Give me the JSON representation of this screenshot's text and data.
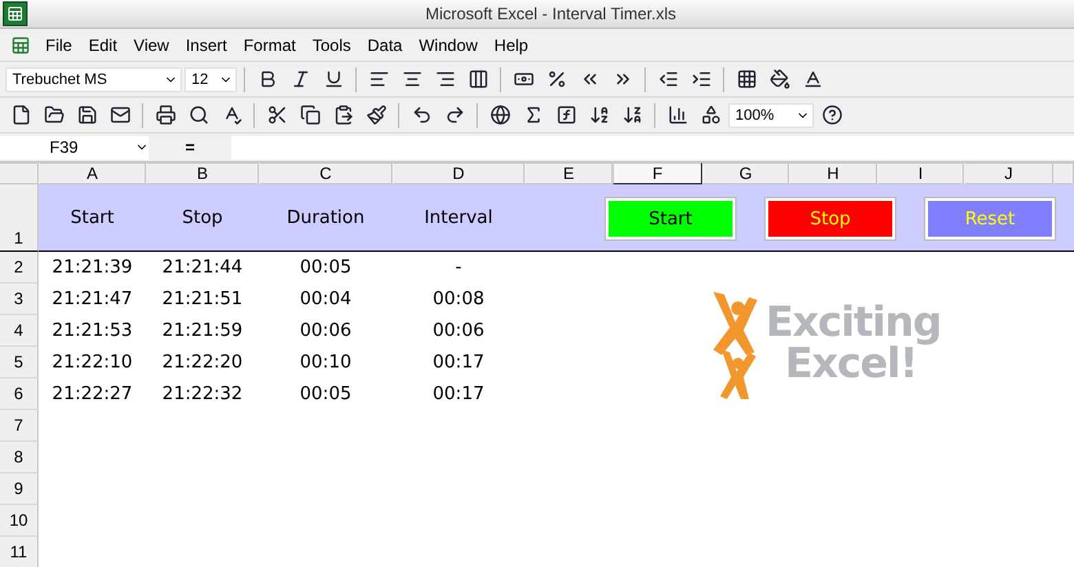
{
  "window": {
    "title": "Microsoft Excel - Interval Timer.xls"
  },
  "menu": [
    "File",
    "Edit",
    "View",
    "Insert",
    "Format",
    "Tools",
    "Data",
    "Window",
    "Help"
  ],
  "formatting_toolbar": {
    "font": "Trebuchet MS",
    "size": "12"
  },
  "standard_toolbar": {
    "zoom": "100%"
  },
  "formula_bar": {
    "name_box": "F39",
    "equals": "="
  },
  "columns": [
    {
      "label": "A",
      "selected": false
    },
    {
      "label": "B",
      "selected": false
    },
    {
      "label": "C",
      "selected": false
    },
    {
      "label": "D",
      "selected": false
    },
    {
      "label": "E",
      "selected": false
    },
    {
      "label": "F",
      "selected": true
    },
    {
      "label": "G",
      "selected": false
    },
    {
      "label": "H",
      "selected": false
    },
    {
      "label": "I",
      "selected": false
    },
    {
      "label": "J",
      "selected": false
    }
  ],
  "rows": [
    {
      "number": "1",
      "cells": [
        "Start",
        "Stop",
        "Duration",
        "Interval"
      ]
    },
    {
      "number": "2",
      "cells": [
        "21:21:39",
        "21:21:44",
        "00:05",
        "-"
      ]
    },
    {
      "number": "3",
      "cells": [
        "21:21:47",
        "21:21:51",
        "00:04",
        "00:08"
      ]
    },
    {
      "number": "4",
      "cells": [
        "21:21:53",
        "21:21:59",
        "00:06",
        "00:06"
      ]
    },
    {
      "number": "5",
      "cells": [
        "21:22:10",
        "21:22:20",
        "00:10",
        "00:17"
      ]
    },
    {
      "number": "6",
      "cells": [
        "21:22:27",
        "21:22:32",
        "00:05",
        "00:17"
      ]
    },
    {
      "number": "7"
    },
    {
      "number": "8"
    },
    {
      "number": "9"
    },
    {
      "number": "10"
    },
    {
      "number": "11"
    }
  ],
  "buttons": [
    {
      "label": "Start",
      "kind": "start",
      "color": "#00ff00"
    },
    {
      "label": "Stop",
      "kind": "stop",
      "color": "#ff0000"
    },
    {
      "label": "Reset",
      "kind": "reset",
      "color": "#8080ff"
    }
  ],
  "logo": {
    "lines": [
      "Exciting",
      "Excel!"
    ]
  }
}
